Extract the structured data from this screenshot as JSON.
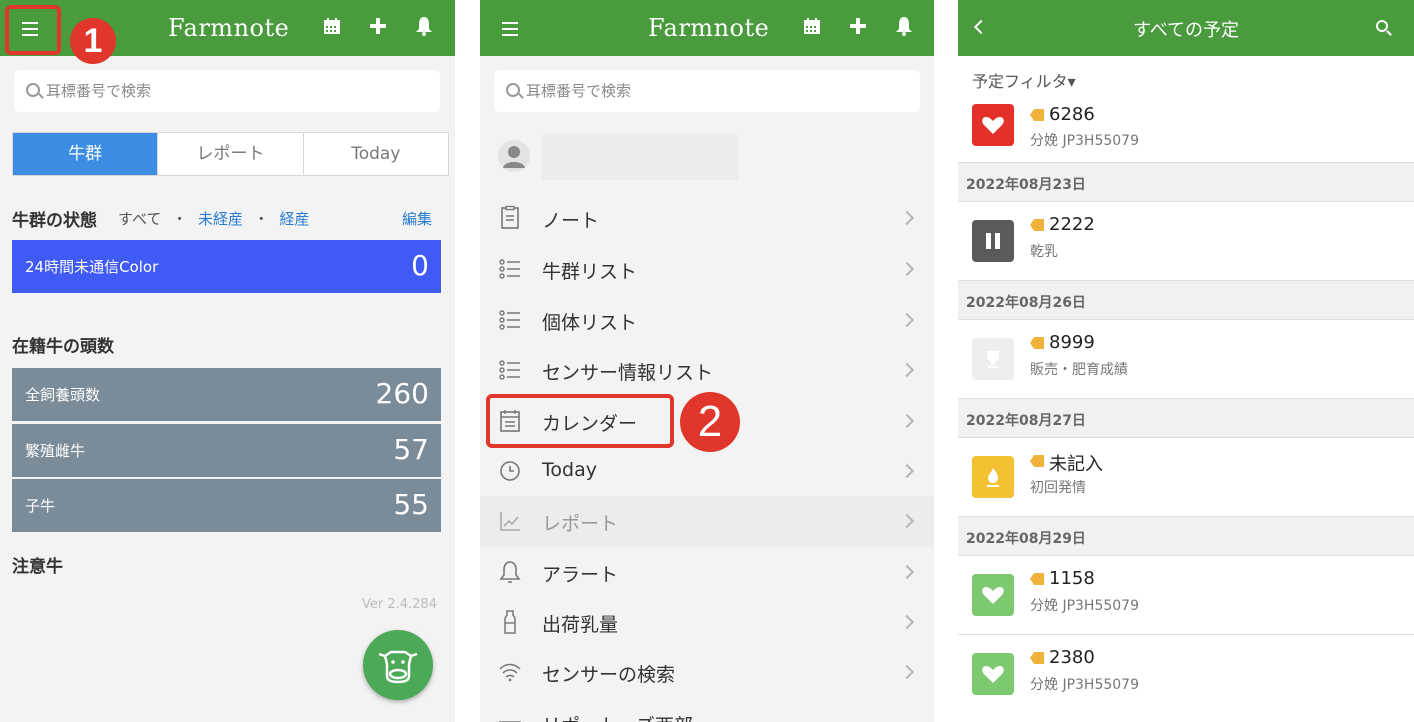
{
  "colors": {
    "brand_green": "#4a9a3e",
    "callout_red": "#e0362c",
    "tab_blue": "#3d8de4",
    "status_blue": "#3f5af5",
    "count_gray": "#7a8b99",
    "link_blue": "#2a7bd4"
  },
  "header": {
    "logo": "Farmnote"
  },
  "search": {
    "placeholder": "耳標番号で検索"
  },
  "callouts": {
    "one": "1",
    "two": "2"
  },
  "home": {
    "tabs": [
      {
        "label": "牛群",
        "active": true
      },
      {
        "label": "レポート"
      },
      {
        "label": "Today"
      }
    ],
    "herd_status": {
      "title": "牛群の状態",
      "filter_all": "すべて",
      "sep": "・",
      "filter_unstaged": "未経産",
      "filter_staged": "経産",
      "edit": "編集"
    },
    "status_rows": [
      {
        "label": "24時間未通信Color",
        "value": "0"
      }
    ],
    "registered": {
      "title": "在籍牛の頭数"
    },
    "count_rows": [
      {
        "label": "全飼養頭数",
        "value": "260"
      },
      {
        "label": "繁殖雌牛",
        "value": "57"
      },
      {
        "label": "子牛",
        "value": "55"
      }
    ],
    "attention": {
      "title": "注意牛"
    },
    "version": "Ver 2.4.284"
  },
  "menu": {
    "items": [
      {
        "label": "ノート",
        "icon": "note-icon"
      },
      {
        "label": "牛群リスト",
        "icon": "list-icon"
      },
      {
        "label": "個体リスト",
        "icon": "list-icon"
      },
      {
        "label": "センサー情報リスト",
        "icon": "list-icon"
      },
      {
        "label": "カレンダー",
        "icon": "calendar-icon"
      },
      {
        "label": "Today",
        "icon": "clock-icon"
      },
      {
        "label": "レポート",
        "icon": "chart-icon"
      },
      {
        "label": "アラート",
        "icon": "bell-icon"
      },
      {
        "label": "出荷乳量",
        "icon": "milk-bottle-icon"
      },
      {
        "label": "センサーの検索",
        "icon": "wifi-icon"
      },
      {
        "label": "リポートーズ西部",
        "icon": "mail-icon"
      }
    ]
  },
  "schedule": {
    "title": "すべての予定",
    "filter": "予定フィルタ▾",
    "first_event": {
      "id": "6286",
      "sub": "分娩 JP3H55079",
      "icon": "heart-icon",
      "color": "#e5302a"
    },
    "groups": [
      {
        "date": "2022年08月23日",
        "events": [
          {
            "id": "2222",
            "sub": "乾乳",
            "icon": "pause-icon",
            "color": "#5a5a5a"
          }
        ]
      },
      {
        "date": "2022年08月26日",
        "events": [
          {
            "id": "8999",
            "sub": "販売・肥育成績",
            "icon": "trophy-icon",
            "color": "#eeeeee"
          }
        ]
      },
      {
        "date": "2022年08月27日",
        "events": [
          {
            "id": "未記入",
            "sub": "初回発情",
            "icon": "flame-icon",
            "color": "#f2c232"
          }
        ]
      },
      {
        "date": "2022年08月29日",
        "events": [
          {
            "id": "1158",
            "sub": "分娩 JP3H55079",
            "icon": "heart-icon",
            "color": "#7cc96f"
          },
          {
            "id": "2380",
            "sub": "分娩 JP3H55079",
            "icon": "heart-icon",
            "color": "#7cc96f"
          }
        ]
      }
    ]
  }
}
